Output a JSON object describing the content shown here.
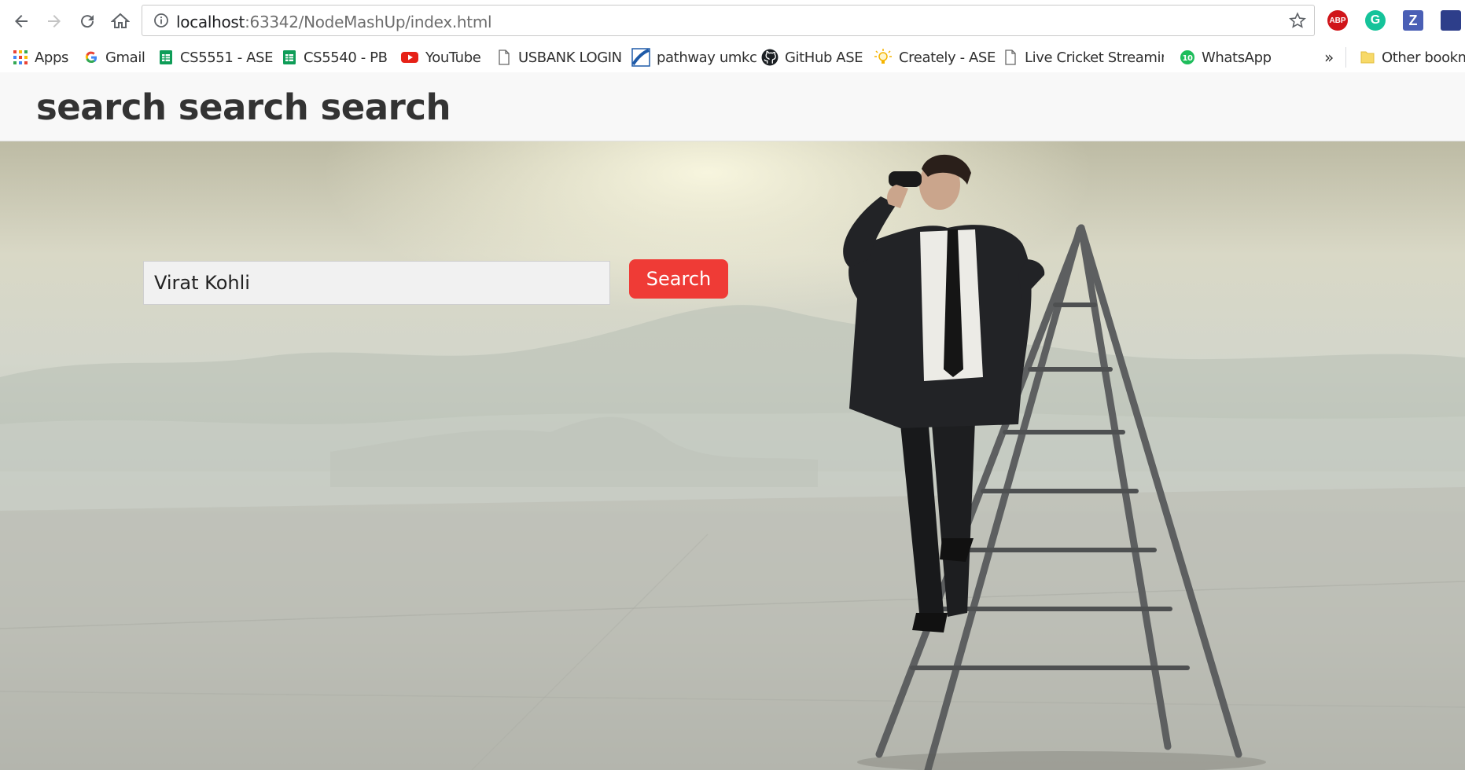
{
  "browser": {
    "url_host": "localhost",
    "url_rest": ":63342/NodeMashUp/index.html",
    "extensions": [
      {
        "name": "abp-icon",
        "label": "ABP",
        "color": "#d0151a"
      },
      {
        "name": "grammarly-icon",
        "label": "G",
        "color": "#15c39a"
      },
      {
        "name": "z-extension-icon",
        "label": "Z",
        "color": "#4a5fb5"
      }
    ]
  },
  "bookmarks": {
    "items": [
      {
        "label": "Apps",
        "icon": "apps-grid-icon"
      },
      {
        "label": "Gmail",
        "icon": "google-icon"
      },
      {
        "label": "CS5551 - ASE",
        "icon": "sheets-icon"
      },
      {
        "label": "CS5540 - PB",
        "icon": "sheets-icon"
      },
      {
        "label": "YouTube",
        "icon": "youtube-icon"
      },
      {
        "label": "USBANK LOGIN",
        "icon": "page-icon"
      },
      {
        "label": "pathway umkc",
        "icon": "pathway-icon"
      },
      {
        "label": "GitHub ASE",
        "icon": "github-icon"
      },
      {
        "label": "Creately - ASE",
        "icon": "bulb-icon"
      },
      {
        "label": "Live Cricket Streaming",
        "icon": "page-icon"
      },
      {
        "label": "WhatsApp",
        "icon": "whatsapp-icon"
      }
    ],
    "more": "»",
    "other": "Other bookm"
  },
  "page": {
    "title": "search search search",
    "search_value": "Virat Kohli",
    "search_button": "Search",
    "accent": "#ef3b36"
  }
}
